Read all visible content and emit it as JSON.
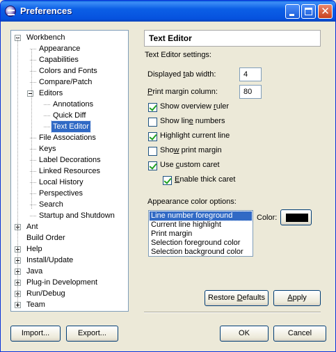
{
  "window": {
    "title": "Preferences"
  },
  "title_buttons": {
    "minimize": "minimize-icon",
    "maximize": "maximize-icon",
    "close": "close-icon",
    "close_glyph": "✕"
  },
  "tree": {
    "items": [
      {
        "label": "Workbench",
        "level": 0,
        "expander": "minus"
      },
      {
        "label": "Appearance",
        "level": 1
      },
      {
        "label": "Capabilities",
        "level": 1
      },
      {
        "label": "Colors and Fonts",
        "level": 1
      },
      {
        "label": "Compare/Patch",
        "level": 1
      },
      {
        "label": "Editors",
        "level": 1,
        "expander": "minus"
      },
      {
        "label": "Annotations",
        "level": 2
      },
      {
        "label": "Quick Diff",
        "level": 2
      },
      {
        "label": "Text Editor",
        "level": 2,
        "selected": true
      },
      {
        "label": "File Associations",
        "level": 1
      },
      {
        "label": "Keys",
        "level": 1
      },
      {
        "label": "Label Decorations",
        "level": 1
      },
      {
        "label": "Linked Resources",
        "level": 1
      },
      {
        "label": "Local History",
        "level": 1
      },
      {
        "label": "Perspectives",
        "level": 1
      },
      {
        "label": "Search",
        "level": 1
      },
      {
        "label": "Startup and Shutdown",
        "level": 1
      },
      {
        "label": "Ant",
        "level": 0,
        "expander": "plus"
      },
      {
        "label": "Build Order",
        "level": 0
      },
      {
        "label": "Help",
        "level": 0,
        "expander": "plus"
      },
      {
        "label": "Install/Update",
        "level": 0,
        "expander": "plus"
      },
      {
        "label": "Java",
        "level": 0,
        "expander": "plus"
      },
      {
        "label": "Plug-in Development",
        "level": 0,
        "expander": "plus"
      },
      {
        "label": "Run/Debug",
        "level": 0,
        "expander": "plus"
      },
      {
        "label": "Team",
        "level": 0,
        "expander": "plus"
      }
    ]
  },
  "page": {
    "header": "Text Editor",
    "settings_label": "Text Editor settings:",
    "tab_width": {
      "label_pre": "Displayed ",
      "label_u": "t",
      "label_post": "ab width:",
      "value": "4"
    },
    "print_margin": {
      "label_pre": "",
      "label_u": "P",
      "label_post": "rint margin column:",
      "value": "80"
    },
    "checkboxes": [
      {
        "pre": "Show overview ",
        "u": "r",
        "post": "uler",
        "checked": true
      },
      {
        "pre": "Show lin",
        "u": "e",
        "post": " numbers",
        "checked": false
      },
      {
        "pre": "Hi",
        "u": "g",
        "post": "hlight current line",
        "checked": true
      },
      {
        "pre": "Sho",
        "u": "w",
        "post": " print margin",
        "checked": false
      },
      {
        "pre": "Use ",
        "u": "c",
        "post": "ustom caret",
        "checked": true
      },
      {
        "pre": "",
        "u": "E",
        "post": "nable thick caret",
        "checked": true
      }
    ],
    "appearance_label": "Appearance color options:",
    "color_options": [
      "Line number foreground",
      "Current line highlight",
      "Print margin",
      "Selection foreground color",
      "Selection background color"
    ],
    "selected_color_option": "Line number foreground",
    "color_label": "Color:",
    "color_value": "#000000",
    "restore_pre": "Restore ",
    "restore_u": "D",
    "restore_post": "efaults",
    "apply_u": "A",
    "apply_post": "pply"
  },
  "footer": {
    "import": "Import...",
    "export": "Export...",
    "ok": "OK",
    "cancel": "Cancel"
  }
}
